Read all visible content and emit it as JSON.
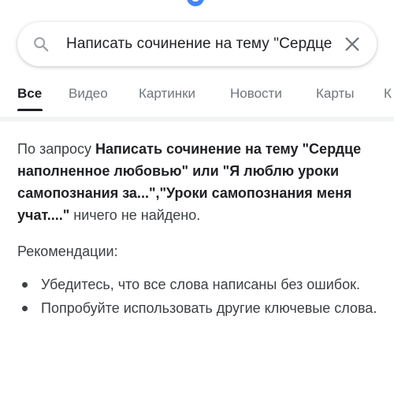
{
  "search": {
    "query": "Написать сочинение на тему \"Сердце наполненное любовью\" или \"Я люблю уроки самопознания за...\",\"Уроки самопознания меня учат....\""
  },
  "tabs": [
    {
      "label": "Все",
      "active": true
    },
    {
      "label": "Видео"
    },
    {
      "label": "Картинки"
    },
    {
      "label": "Новости"
    },
    {
      "label": "Карты"
    },
    {
      "label": "К"
    }
  ],
  "results": {
    "no_results_prefix": "По запросу ",
    "no_results_query": "Написать сочинение на тему \"Сердце наполненное любовью\" или \"Я люблю уроки самопознания за...\",\"Уроки самопознания меня учат....\"",
    "no_results_suffix": " ничего не найдено.",
    "recommendations_title": "Рекомендации:",
    "recommendations": [
      "Убедитесь, что все слова написаны без ошибок.",
      "Попробуйте использовать другие ключевые слова."
    ]
  },
  "colors": {
    "active_tab": "#202124",
    "inactive_tab": "#70757a",
    "body_text": "#3c4043",
    "search_icon": "#9aa0a6",
    "clear_icon": "#70757a"
  },
  "icons": {
    "search": "search-icon",
    "clear": "close-icon"
  }
}
